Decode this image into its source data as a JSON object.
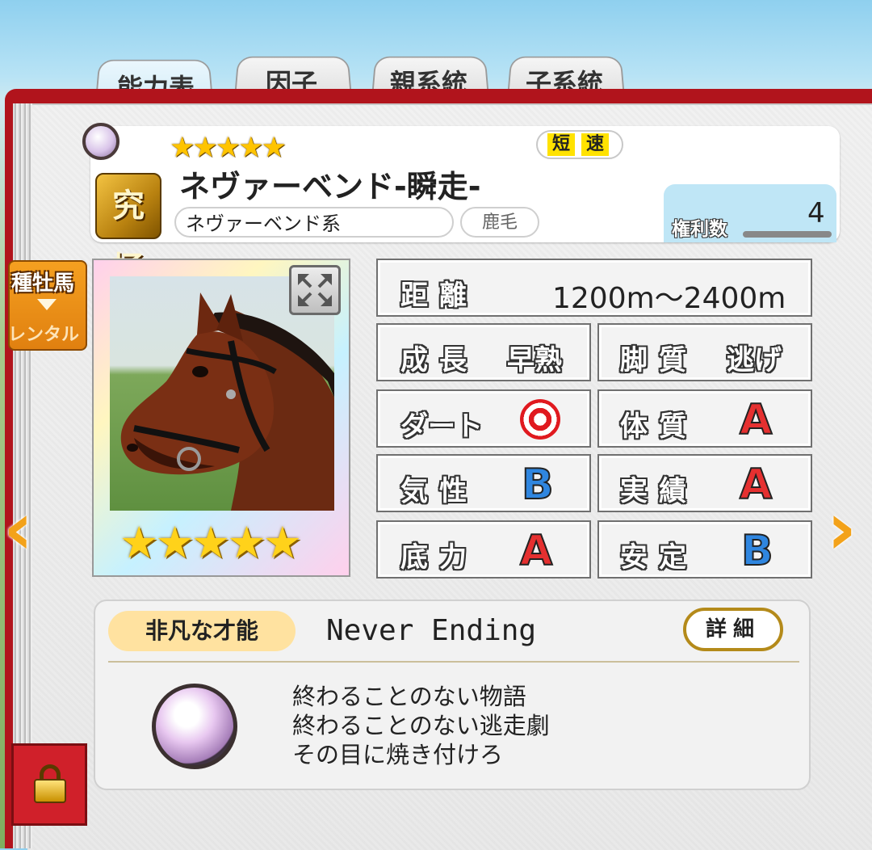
{
  "tabs": [
    {
      "label": "能力表",
      "active": true
    },
    {
      "label": "因子",
      "active": false
    },
    {
      "label": "親系統",
      "active": false
    },
    {
      "label": "子系統",
      "active": false
    }
  ],
  "horse": {
    "rarity_stars": "★★★★★",
    "badge": "究極",
    "name": "ネヴァーベンド-瞬走-",
    "lineage": "ネヴァーベンド系",
    "coat": "鹿毛",
    "aptitudes": [
      "短",
      "速"
    ],
    "rights_label": "権利数",
    "rights_count": "4",
    "portrait_stars": "★★★★★"
  },
  "stats": {
    "distance": {
      "label": "距離",
      "value": "1200m〜2400m"
    },
    "growth": {
      "label": "成長",
      "value": "早熟"
    },
    "running_style": {
      "label": "脚質",
      "value": "逃げ"
    },
    "dirt": {
      "label": "ダート",
      "value": "◎"
    },
    "constitution": {
      "label": "体質",
      "value": "A"
    },
    "temperament": {
      "label": "気性",
      "value": "B"
    },
    "record": {
      "label": "実績",
      "value": "A"
    },
    "stamina": {
      "label": "底力",
      "value": "A"
    },
    "stability": {
      "label": "安定",
      "value": "B"
    }
  },
  "ability": {
    "tag": "非凡な才能",
    "name": "Never Ending",
    "detail_label": "詳細",
    "description": [
      "終わることのない物語",
      "終わることのない逃走劇",
      "その目に焼き付けろ"
    ]
  },
  "side": {
    "stud_label": "種牡馬",
    "rental_label": "レンタル",
    "prev_arrow": "‹",
    "next_arrow": "›"
  },
  "colors": {
    "book": "#b1141c",
    "grade_a": "#e53030",
    "grade_b": "#2f86e0",
    "stud_tag": "#f5a020"
  }
}
